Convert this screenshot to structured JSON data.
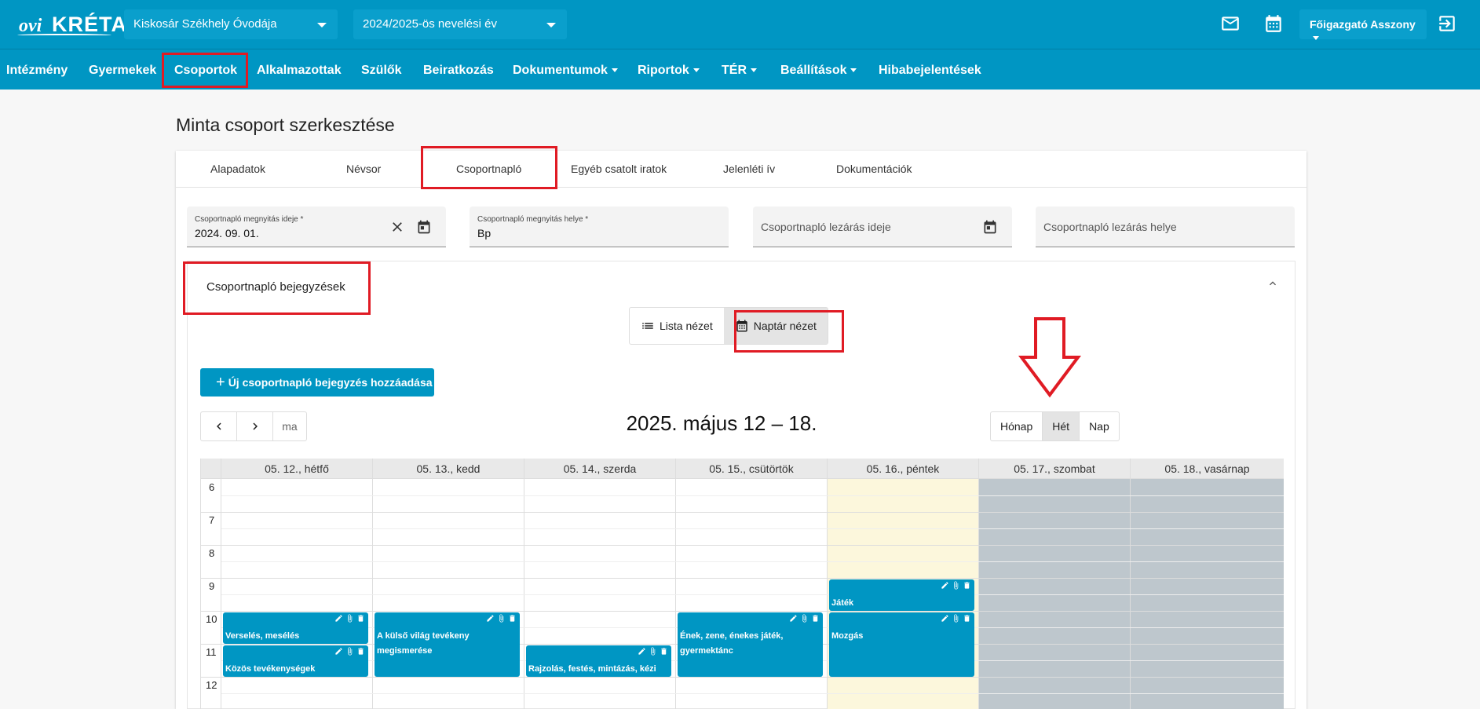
{
  "app": {
    "logo_prefix": "ovi",
    "logo_main": "KRÉTA"
  },
  "header": {
    "institution": "Kiskosár Székhely Óvodája",
    "school_year": "2024/2025-ös nevelési év",
    "user": "Főigazgató Asszony"
  },
  "nav": [
    {
      "label": "Intézmény",
      "dropdown": false
    },
    {
      "label": "Gyermekek",
      "dropdown": false
    },
    {
      "label": "Csoportok",
      "dropdown": false
    },
    {
      "label": "Alkalmazottak",
      "dropdown": false
    },
    {
      "label": "Szülők",
      "dropdown": false
    },
    {
      "label": "Beiratkozás",
      "dropdown": false
    },
    {
      "label": "Dokumentumok",
      "dropdown": true
    },
    {
      "label": "Riportok",
      "dropdown": true
    },
    {
      "label": "TÉR",
      "dropdown": true
    },
    {
      "label": "Beállítások",
      "dropdown": true
    },
    {
      "label": "Hibabejelentések",
      "dropdown": false
    }
  ],
  "page": {
    "title": "Minta csoport szerkesztése"
  },
  "tabs": [
    "Alapadatok",
    "Névsor",
    "Csoportnapló",
    "Egyéb csatolt iratok",
    "Jelenléti ív",
    "Dokumentációk"
  ],
  "fields": {
    "open_date": {
      "label": "Csoportnapló megnyitás ideje *",
      "value": "2024. 09. 01."
    },
    "open_place": {
      "label": "Csoportnapló megnyitás helye *",
      "value": "Bp"
    },
    "close_date": {
      "placeholder": "Csoportnapló lezárás ideje"
    },
    "close_place": {
      "placeholder": "Csoportnapló lezárás helye"
    }
  },
  "entries": {
    "title": "Csoportnapló bejegyzések",
    "list_view": "Lista nézet",
    "calendar_view": "Naptár nézet",
    "add_button": "Új csoportnapló bejegyzés hozzáadása"
  },
  "calendar": {
    "range": "2025. május 12 – 18.",
    "today_button": "ma",
    "views": [
      "Hónap",
      "Hét",
      "Nap"
    ],
    "active_view": "Hét",
    "days": [
      "05. 12., hétfő",
      "05. 13., kedd",
      "05. 14., szerda",
      "05. 15., csütörtök",
      "05. 16., péntek",
      "05. 17., szombat",
      "05. 18., vasárnap"
    ],
    "hours": [
      "6",
      "7",
      "8",
      "9",
      "10",
      "11",
      "12"
    ],
    "events": [
      {
        "title": "Verselés, mesélés"
      },
      {
        "title": "Közös tevékenységek"
      },
      {
        "title": "A külső világ tevékeny megismerése"
      },
      {
        "title": "Rajzolás, festés, mintázás, kézi"
      },
      {
        "title": "Ének, zene, énekes játék, gyermektánc"
      },
      {
        "title": "Játék"
      },
      {
        "title": "Mozgás"
      }
    ]
  },
  "colors": {
    "primary": "#0096c3",
    "highlight": "#e01b24",
    "today": "#fcf7dc",
    "weekend": "#bec7cd"
  }
}
